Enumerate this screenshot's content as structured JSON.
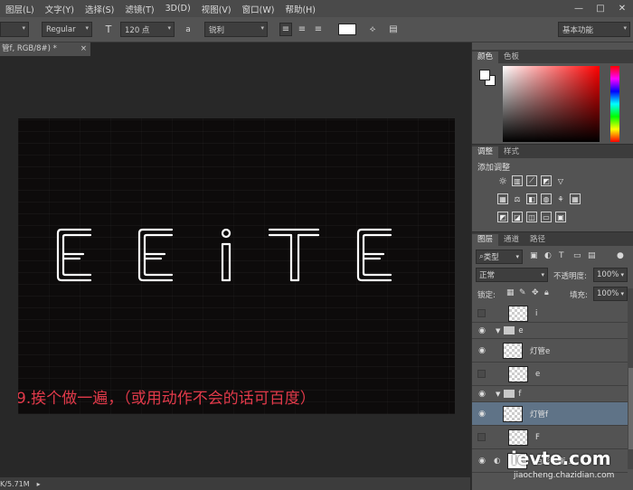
{
  "menubar": {
    "items": [
      "图层(L)",
      "文字(Y)",
      "选择(S)",
      "滤镜(T)",
      "3D(D)",
      "视图(V)",
      "窗口(W)",
      "帮助(H)"
    ],
    "window_controls": [
      "—",
      "□",
      "✕"
    ]
  },
  "options": {
    "font_style": "Regular",
    "font_size": "120 点",
    "aa_label": "a",
    "aa_mode": "锐利",
    "workspace": "基本功能"
  },
  "document_tab": {
    "title": "管f, RGB/8#) *",
    "close": "×"
  },
  "canvas": {
    "neon_text": "EEiTE",
    "caption": "9.挨个做一遍，（或用动作不会的话可百度）"
  },
  "statusbar": {
    "text": "K/5.71M",
    "arrow": "▸"
  },
  "color_panel": {
    "tabs": [
      "颜色",
      "色板"
    ],
    "foreground": "#ffffff",
    "background": "#ffffff"
  },
  "adjustments_panel": {
    "tabs": [
      "调整",
      "样式"
    ],
    "title": "添加调整"
  },
  "layers_panel": {
    "tabs": [
      "图层",
      "通道",
      "路径"
    ],
    "filter_kind": "类型",
    "blend_mode": "正常",
    "opacity_label": "不透明度:",
    "opacity_value": "100%",
    "lock_label": "锁定:",
    "fill_label": "填充:",
    "fill_value": "100%",
    "layers": [
      {
        "name": "i",
        "visible": false,
        "kind": "layer"
      },
      {
        "name": "e",
        "visible": true,
        "kind": "group"
      },
      {
        "name": "灯管e",
        "visible": true,
        "kind": "layer"
      },
      {
        "name": "e",
        "visible": false,
        "kind": "layer"
      },
      {
        "name": "f",
        "visible": true,
        "kind": "group"
      },
      {
        "name": "灯管f",
        "visible": true,
        "kind": "layer",
        "selected": true
      },
      {
        "name": "F",
        "visible": false,
        "kind": "layer"
      },
      {
        "name": "色彩平衡 1",
        "visible": true,
        "kind": "adjustment"
      }
    ]
  },
  "watermark": {
    "main": "ievte.com",
    "sub": "jiaocheng.chazidian.com"
  }
}
